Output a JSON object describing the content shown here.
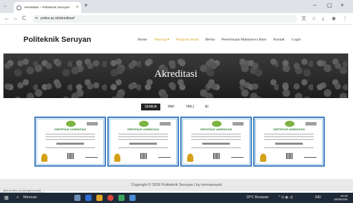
{
  "browser": {
    "tab_title": "Akreditasi – Politeknik Seruyan",
    "close_glyph": "×",
    "newtab_glyph": "+",
    "menu_glyph": "⌄",
    "url": "poltes.ac.id/akreditasi/",
    "win_min": "–",
    "win_max": "▢",
    "win_close": "×",
    "back": "←",
    "forward": "→",
    "reload": "C",
    "tune": "⇆",
    "star": "☆",
    "download": "⤓",
    "profile": "◉",
    "more": "⋮",
    "translate": "文"
  },
  "site": {
    "brand": "Politeknik Seruyan",
    "nav": [
      "Home",
      "Tentang",
      "Program Studi",
      "Berita",
      "Penerimaan Mahasiswa Baru",
      "Kontak",
      "Login"
    ],
    "tentang_caret": "▾",
    "hero_title": "Akreditasi",
    "filters": [
      "SEMUA",
      "PAP",
      "TRKJ",
      "BI"
    ],
    "certificates": [
      {
        "title": "SERTIFIKAT AKREDITASI"
      },
      {
        "title": "SERTIFIKAT AKREDITASI"
      },
      {
        "title": "SERTIFIKAT AKREDITASI"
      },
      {
        "title": "SERTIFIKAT AKREDITASI"
      }
    ],
    "footer": "Copyright © 2026 Politeknik Seruyan | by hermansyah",
    "status_url": "https://poltes.ac.id/program-studi/"
  },
  "taskbar": {
    "start_glyph": "⊞",
    "search_label": "Mencari",
    "search_glyph": "⌕",
    "weather": "29°C Berawan",
    "tray_icons": "^  ⊡  ◉  ◁)",
    "lang": "IND",
    "time": "09:49",
    "date": "18/05/2026"
  },
  "colors": {
    "accent": "#d4a017",
    "cert_border": "#3b7bbf",
    "taskbar": "#1f2a38"
  }
}
